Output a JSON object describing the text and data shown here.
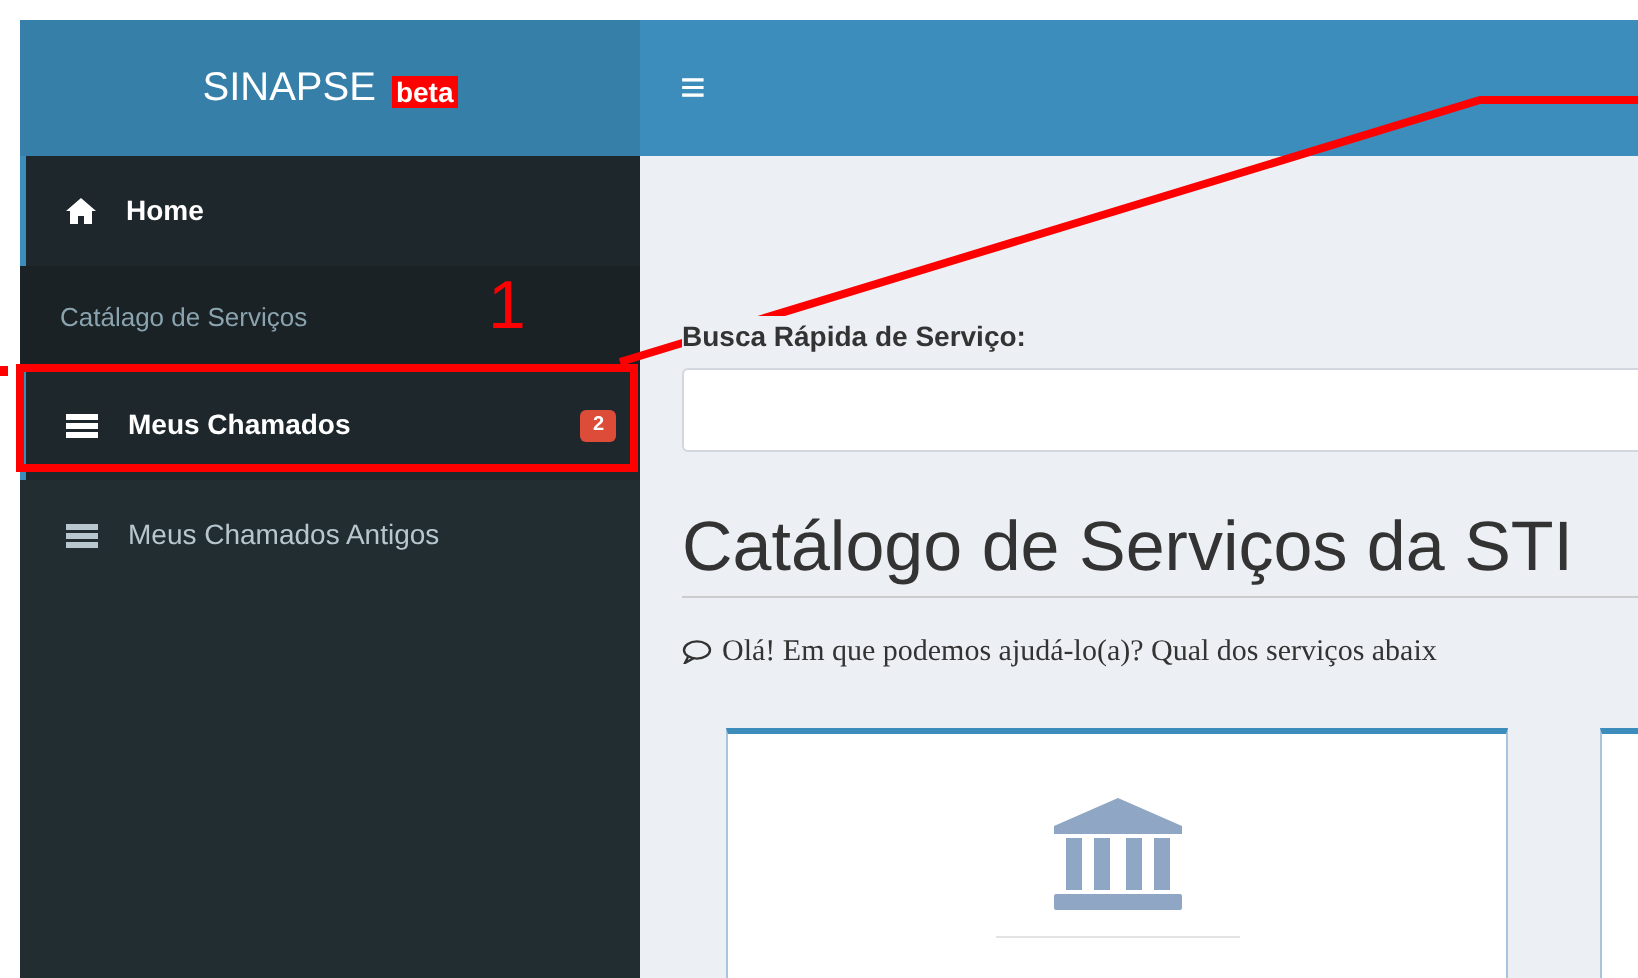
{
  "brand": {
    "name": "SINAPSE",
    "badge": "beta"
  },
  "header": {
    "menu_icon": "≡"
  },
  "sidebar": {
    "items": [
      {
        "kind": "home",
        "label": "Home",
        "selected": true
      },
      {
        "kind": "header",
        "label": "Catálago de Serviços"
      },
      {
        "kind": "list",
        "label": "Meus Chamados",
        "badge": "2",
        "selected": true
      },
      {
        "kind": "list",
        "label": "Meus Chamados Antigos",
        "selected": false
      }
    ]
  },
  "search": {
    "label": "Busca Rápida de Serviço:"
  },
  "page_title": "Catálogo de Serviços da STI",
  "intro": "Olá! Em que podemos ajudá-lo(a)? Qual dos serviços abaix",
  "cards": [
    {
      "kind": "institution"
    },
    {
      "kind": "blank"
    }
  ],
  "annotation": {
    "number": "1"
  }
}
